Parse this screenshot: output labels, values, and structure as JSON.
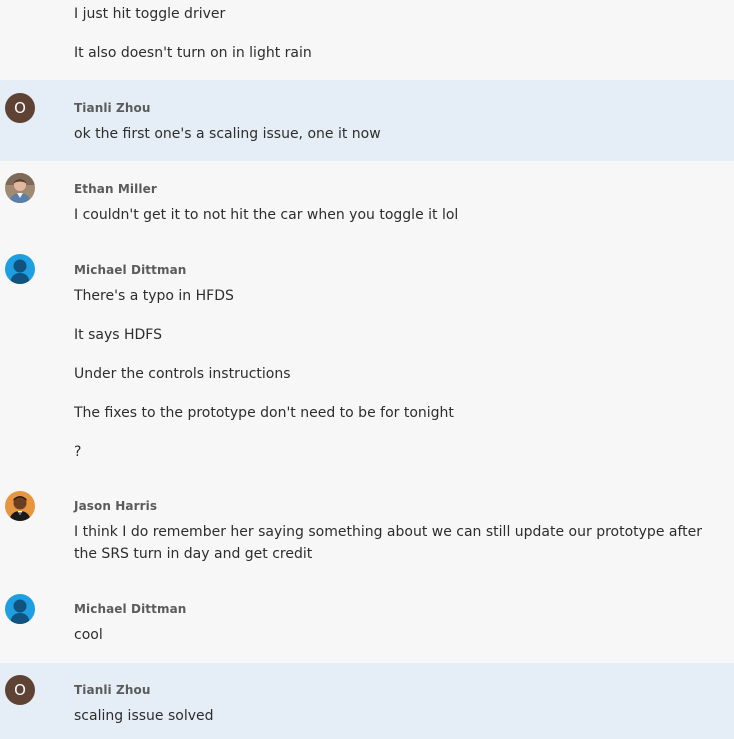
{
  "messages_prev": [
    "I just hit toggle driver",
    "It also doesn't turn on in light rain"
  ],
  "groups": [
    {
      "author": "Tianli Zhou",
      "avatar_initial": "O",
      "avatar_kind": "initial",
      "highlighted": true,
      "messages": [
        "ok the first one's a scaling issue, one it now"
      ]
    },
    {
      "author": "Ethan Miller",
      "avatar_kind": "photo",
      "highlighted": false,
      "messages": [
        "I couldn't get it to not hit the car when you toggle it lol"
      ]
    },
    {
      "author": "Michael Dittman",
      "avatar_kind": "default",
      "highlighted": false,
      "messages": [
        "There's a typo in HFDS",
        "It says HDFS",
        "Under the controls instructions",
        "The fixes to the prototype don't need to be for tonight",
        "?"
      ]
    },
    {
      "author": "Jason Harris",
      "avatar_kind": "photo",
      "highlighted": false,
      "messages": [
        "I think I do remember her saying something about we can still update our prototype after the SRS turn in day and get credit"
      ]
    },
    {
      "author": "Michael Dittman",
      "avatar_kind": "default",
      "highlighted": false,
      "messages": [
        "cool"
      ]
    },
    {
      "author": "Tianli Zhou",
      "avatar_initial": "O",
      "avatar_kind": "initial",
      "highlighted": true,
      "messages": [
        "scaling issue solved"
      ]
    }
  ],
  "colors": {
    "background": "#f7f7f7",
    "highlight": "#e5eef6",
    "initial_avatar": "#5e4233",
    "default_avatar": "#1e9fe2"
  }
}
